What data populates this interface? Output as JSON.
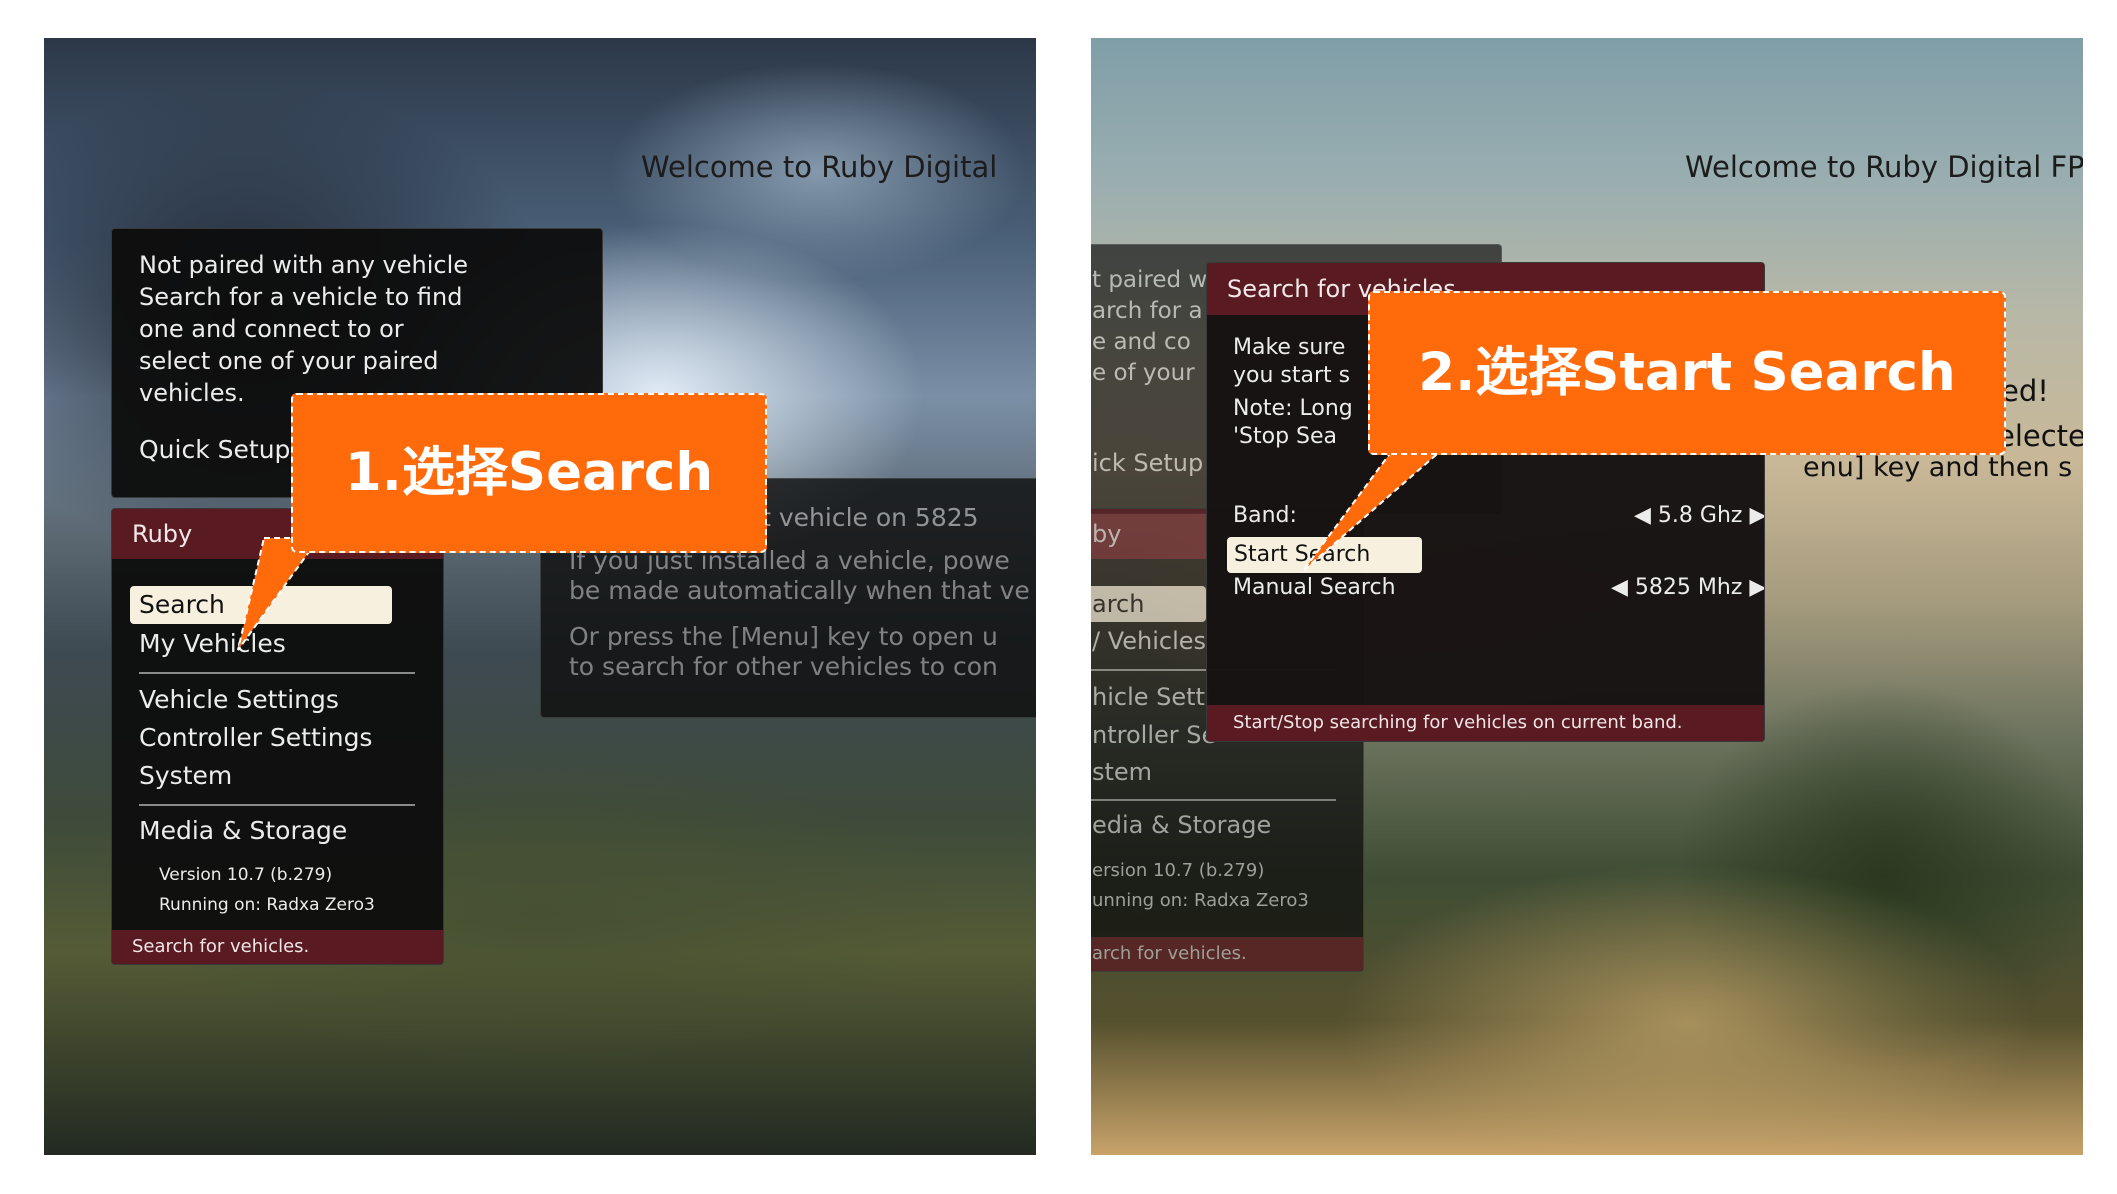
{
  "welcome_left": "Welcome to Ruby Digital",
  "welcome_right": "Welcome to Ruby Digital FP",
  "left": {
    "info_panel": {
      "lines": [
        "Not  paired  with  any  vehicle",
        "Search  for  a  vehicle  to  find",
        "one  and  connect  to  or",
        "select  one  of  your  paired",
        "vehicles."
      ],
      "quick_setup": "Quick Setup"
    },
    "back_panel": {
      "line1": "ault  vehicle  on  5825",
      "line2": "If  you  just  installed  a  vehicle,  powe",
      "line3": "be  made  automatically  when  that  ve",
      "line4": "Or  press  the  [Menu]  key  to  open  u",
      "line5": "to  search  for  other  vehicles  to  con"
    },
    "menu": {
      "title": "Ruby",
      "items": [
        "Search",
        "My Vehicles",
        "Vehicle Settings",
        "Controller Settings",
        "System",
        "Media & Storage"
      ],
      "version": "Version  10.7 (b.279)",
      "running": "Running on:  Radxa Zero3",
      "footer": "Search  for  vehicles."
    },
    "callout": "1.选择Search"
  },
  "right": {
    "info_panel": {
      "lines": [
        "t  paired  w",
        "arch  for  a",
        "e  and  co",
        "e  of  your"
      ],
      "quick_setup": "ick Setup"
    },
    "menu": {
      "title": "by",
      "items": [
        "arch",
        "/ Vehicles",
        "hicle Setti",
        "ntroller Se",
        "stem",
        "edia & Storage"
      ],
      "version": "ersion    10.7  (b.279)",
      "running": "unning    on:  Radxa   Zero3",
      "footer": "arch   for  vehicles."
    },
    "side_text": {
      "line1": "ed!",
      "line2": "electe",
      "line3": "enu]  key  and  then  s"
    },
    "search_dialog": {
      "title": "Search for vehicles",
      "make_sure": "Make  sure",
      "you_start": "you  start  s",
      "note": "Note:  Long",
      "stop": "'Stop  Sea",
      "band_label": "Band:",
      "band_value": "5.8 Ghz",
      "start_search": "Start Search",
      "manual_search": "Manual Search",
      "manual_value": "5825 Mhz",
      "footer": "Start/Stop  searching   for  vehicles   on   current   band."
    },
    "callout": "2.选择Start Search"
  },
  "colors": {
    "accent": "#5a1a22",
    "callout": "#ff6a0a",
    "selected": "#f7f0df"
  },
  "icons": [
    "arrow-left-icon",
    "arrow-right-icon"
  ]
}
